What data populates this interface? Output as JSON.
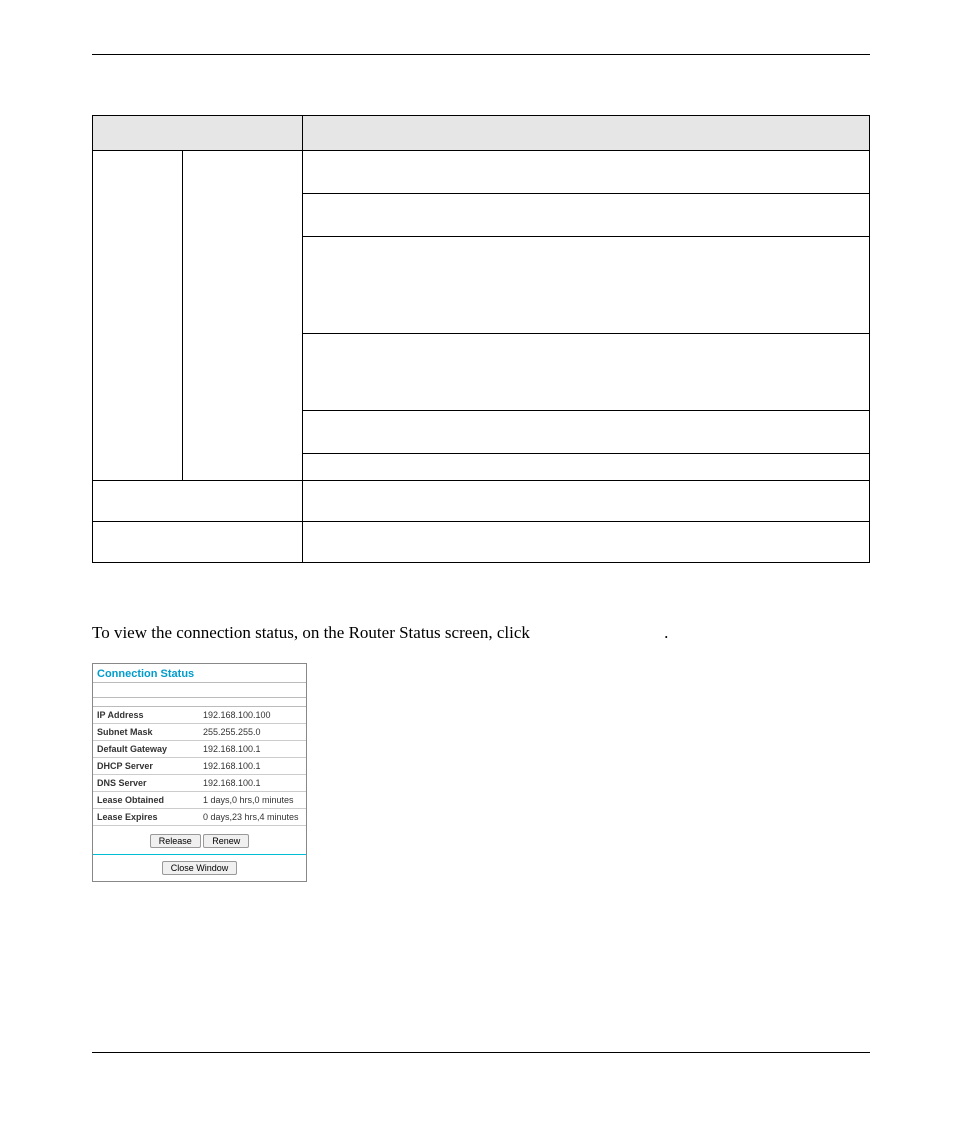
{
  "body_text_prefix": "To view the connection status, on the Router Status screen, click ",
  "body_text_suffix": ".",
  "connection_status": {
    "title": "Connection Status",
    "rows": [
      {
        "label": "IP Address",
        "value": "192.168.100.100"
      },
      {
        "label": "Subnet Mask",
        "value": "255.255.255.0"
      },
      {
        "label": "Default Gateway",
        "value": "192.168.100.1"
      },
      {
        "label": "DHCP Server",
        "value": "192.168.100.1"
      },
      {
        "label": "DNS Server",
        "value": "192.168.100.1"
      },
      {
        "label": "Lease Obtained",
        "value": "1 days,0 hrs,0 minutes"
      },
      {
        "label": "Lease Expires",
        "value": "0 days,23 hrs,4 minutes"
      }
    ],
    "release_label": "Release",
    "renew_label": "Renew",
    "close_label": "Close Window"
  }
}
